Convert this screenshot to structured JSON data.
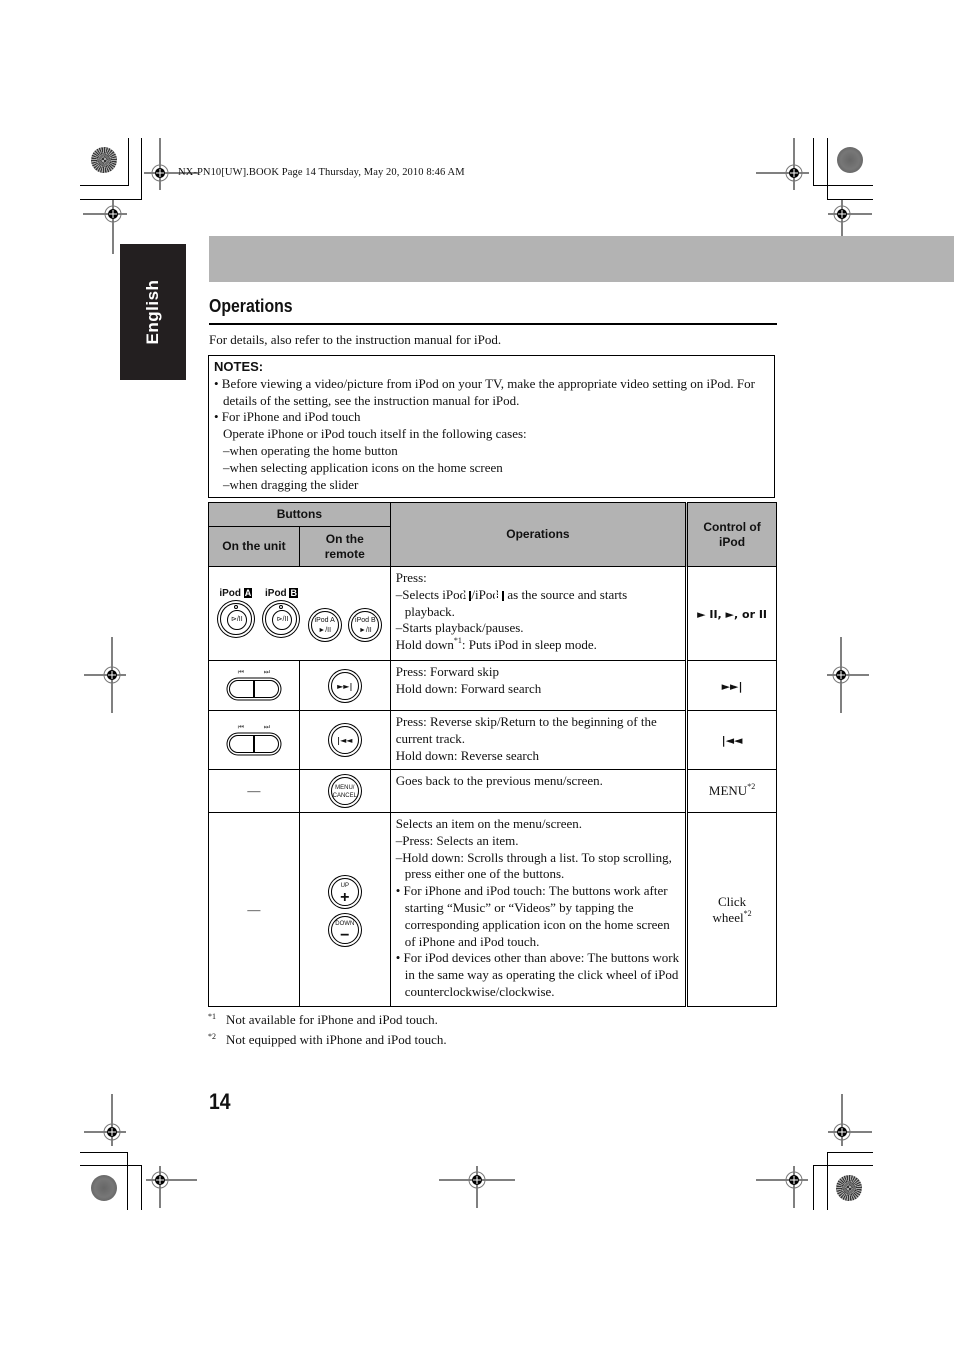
{
  "book_info": "NX-PN10[UW].BOOK  Page 14  Thursday, May 20, 2010  8:46 AM",
  "side_tab": "English",
  "section_title": "Operations",
  "intro": "For details, also refer to the instruction manual for iPod.",
  "notes": {
    "heading": "NOTES:",
    "bullet1": "• Before viewing a video/picture from iPod on your TV, make the appropriate video setting on iPod. For details of the setting, see the instruction manual for iPod.",
    "bullet2": "• For iPhone and iPod touch",
    "bullet2_line": "Operate iPhone or iPod touch itself in the following cases:",
    "cases": [
      "–when operating the home button",
      "–when selecting application icons on the home screen",
      "–when dragging the slider"
    ]
  },
  "table": {
    "headers": {
      "buttons": "Buttons",
      "on_unit": "On the unit",
      "on_remote": "On the remote",
      "operations": "Operations",
      "control": "Control of iPod"
    },
    "rows": [
      {
        "unit_labels": [
          "iPod",
          "A",
          "iPod",
          "B"
        ],
        "unit_button_text": "⊳/II",
        "remote_labels": [
          "iPod A ►/II",
          "iPod B ►/II"
        ],
        "ops": [
          "Press:",
          "–Selects iPod ",
          "/iPod ",
          " as the source and starts playback.",
          "–Starts playback/pauses.",
          "Hold down",
          "*1",
          ": Puts iPod in sleep mode."
        ],
        "ops_letters": [
          "A",
          "B"
        ],
        "control": "► II, ►, or II"
      },
      {
        "rocker_labels": [
          "⏮",
          "⏭"
        ],
        "remote_icon": "►►|",
        "ops": [
          "Press: Forward skip",
          "Hold down: Forward search"
        ],
        "control": "►►|"
      },
      {
        "rocker_labels": [
          "⏮",
          "⏭"
        ],
        "remote_icon": "|◄◄",
        "ops": [
          "Press: Reverse skip/Return to the beginning of the current track.",
          "Hold down: Reverse search"
        ],
        "control": "|◄◄"
      },
      {
        "unit": "—",
        "remote_icon": "MENU/ CANCEL",
        "ops": [
          "Goes back to the previous menu/screen."
        ],
        "control": "MENU",
        "control_sup": "*2"
      },
      {
        "unit": "—",
        "remote_up": "UP",
        "remote_up_sym": "+",
        "remote_down": "DOWN",
        "remote_down_sym": "−",
        "ops": [
          "Selects an item on the menu/screen.",
          "–Press: Selects an item.",
          "–Hold down: Scrolls through a list. To stop scrolling, press either one of the buttons.",
          "• For iPhone and iPod touch: The buttons work after starting “Music” or “Videos” by tapping the corresponding application icon on the home screen of iPhone and iPod touch.",
          "• For iPod devices other than above: The buttons work in the same way as operating the click wheel of iPod counterclockwise/clockwise."
        ],
        "control": "Click wheel",
        "control_sup": "*2"
      }
    ]
  },
  "footnotes": [
    {
      "mark": "*1",
      "text": "Not available for iPhone and iPod touch."
    },
    {
      "mark": "*2",
      "text": "Not equipped with iPhone and iPod touch."
    }
  ],
  "page_number": "14",
  "colors": {
    "header_bar": "#b3b3b3",
    "side_tab": "#231f20",
    "table_header": "#b3b3b3"
  }
}
